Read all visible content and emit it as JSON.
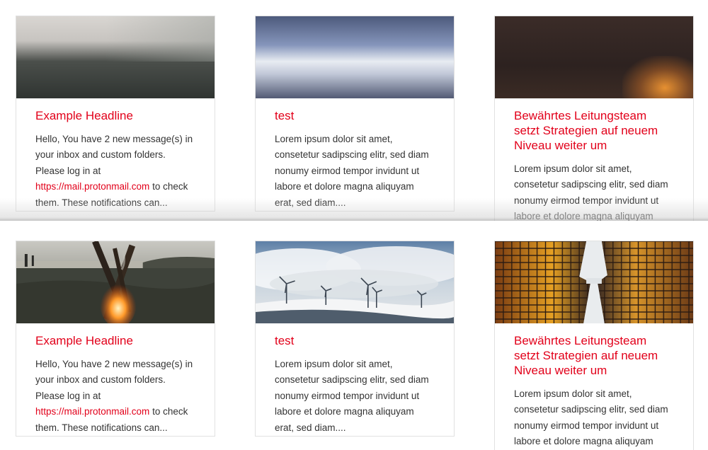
{
  "cards_top": [
    {
      "title": "Example Headline",
      "text_before": "Hello, You have 2 new message(s) in your inbox and custom folders. Please log in at ",
      "link": "https://mail.protonmail.com",
      "text_after": " to check them. These notifications can...",
      "image": "blurred-gray-landscape-image"
    },
    {
      "title": "test",
      "text": "Lorem ipsum dolor sit amet, consetetur sadipscing elitr, sed diam nonumy eirmod tempor invidunt ut labore et dolore magna aliquyam erat, sed diam....",
      "image": "blurred-blue-sky-image"
    },
    {
      "title": "Bewährtes Leitungsteam setzt Strategien auf neuem Niveau weiter um",
      "text": "Lorem ipsum dolor sit amet, consetetur sadipscing elitr, sed diam nonumy eirmod tempor invidunt ut labore et dolore magna aliquyam erat, sed diam....",
      "image": "blurred-dark-orange-image"
    }
  ],
  "cards_bottom": [
    {
      "title": "Example Headline",
      "text_before": "Hello, You have 2 new message(s) in your inbox and custom folders. Please log in at ",
      "link": "https://mail.protonmail.com",
      "text_after": " to check them. These notifications can...",
      "image": "campfire-lake-image"
    },
    {
      "title": "test",
      "text": "Lorem ipsum dolor sit amet, consetetur sadipscing elitr, sed diam nonumy eirmod tempor invidunt ut labore et dolore magna aliquyam erat, sed diam....",
      "image": "wind-turbines-snow-image"
    },
    {
      "title": "Bewährtes Leitungsteam setzt Strategien auf neuem Niveau weiter um",
      "text": "Lorem ipsum dolor sit amet, consetetur sadipscing elitr, sed diam nonumy eirmod tempor invidunt ut labore et dolore magna aliquyam erat, sed diam....",
      "image": "glass-skyscrapers-image"
    }
  ],
  "colors": {
    "accent": "#e2001a",
    "text": "#333333",
    "border": "#e1e1e1"
  }
}
